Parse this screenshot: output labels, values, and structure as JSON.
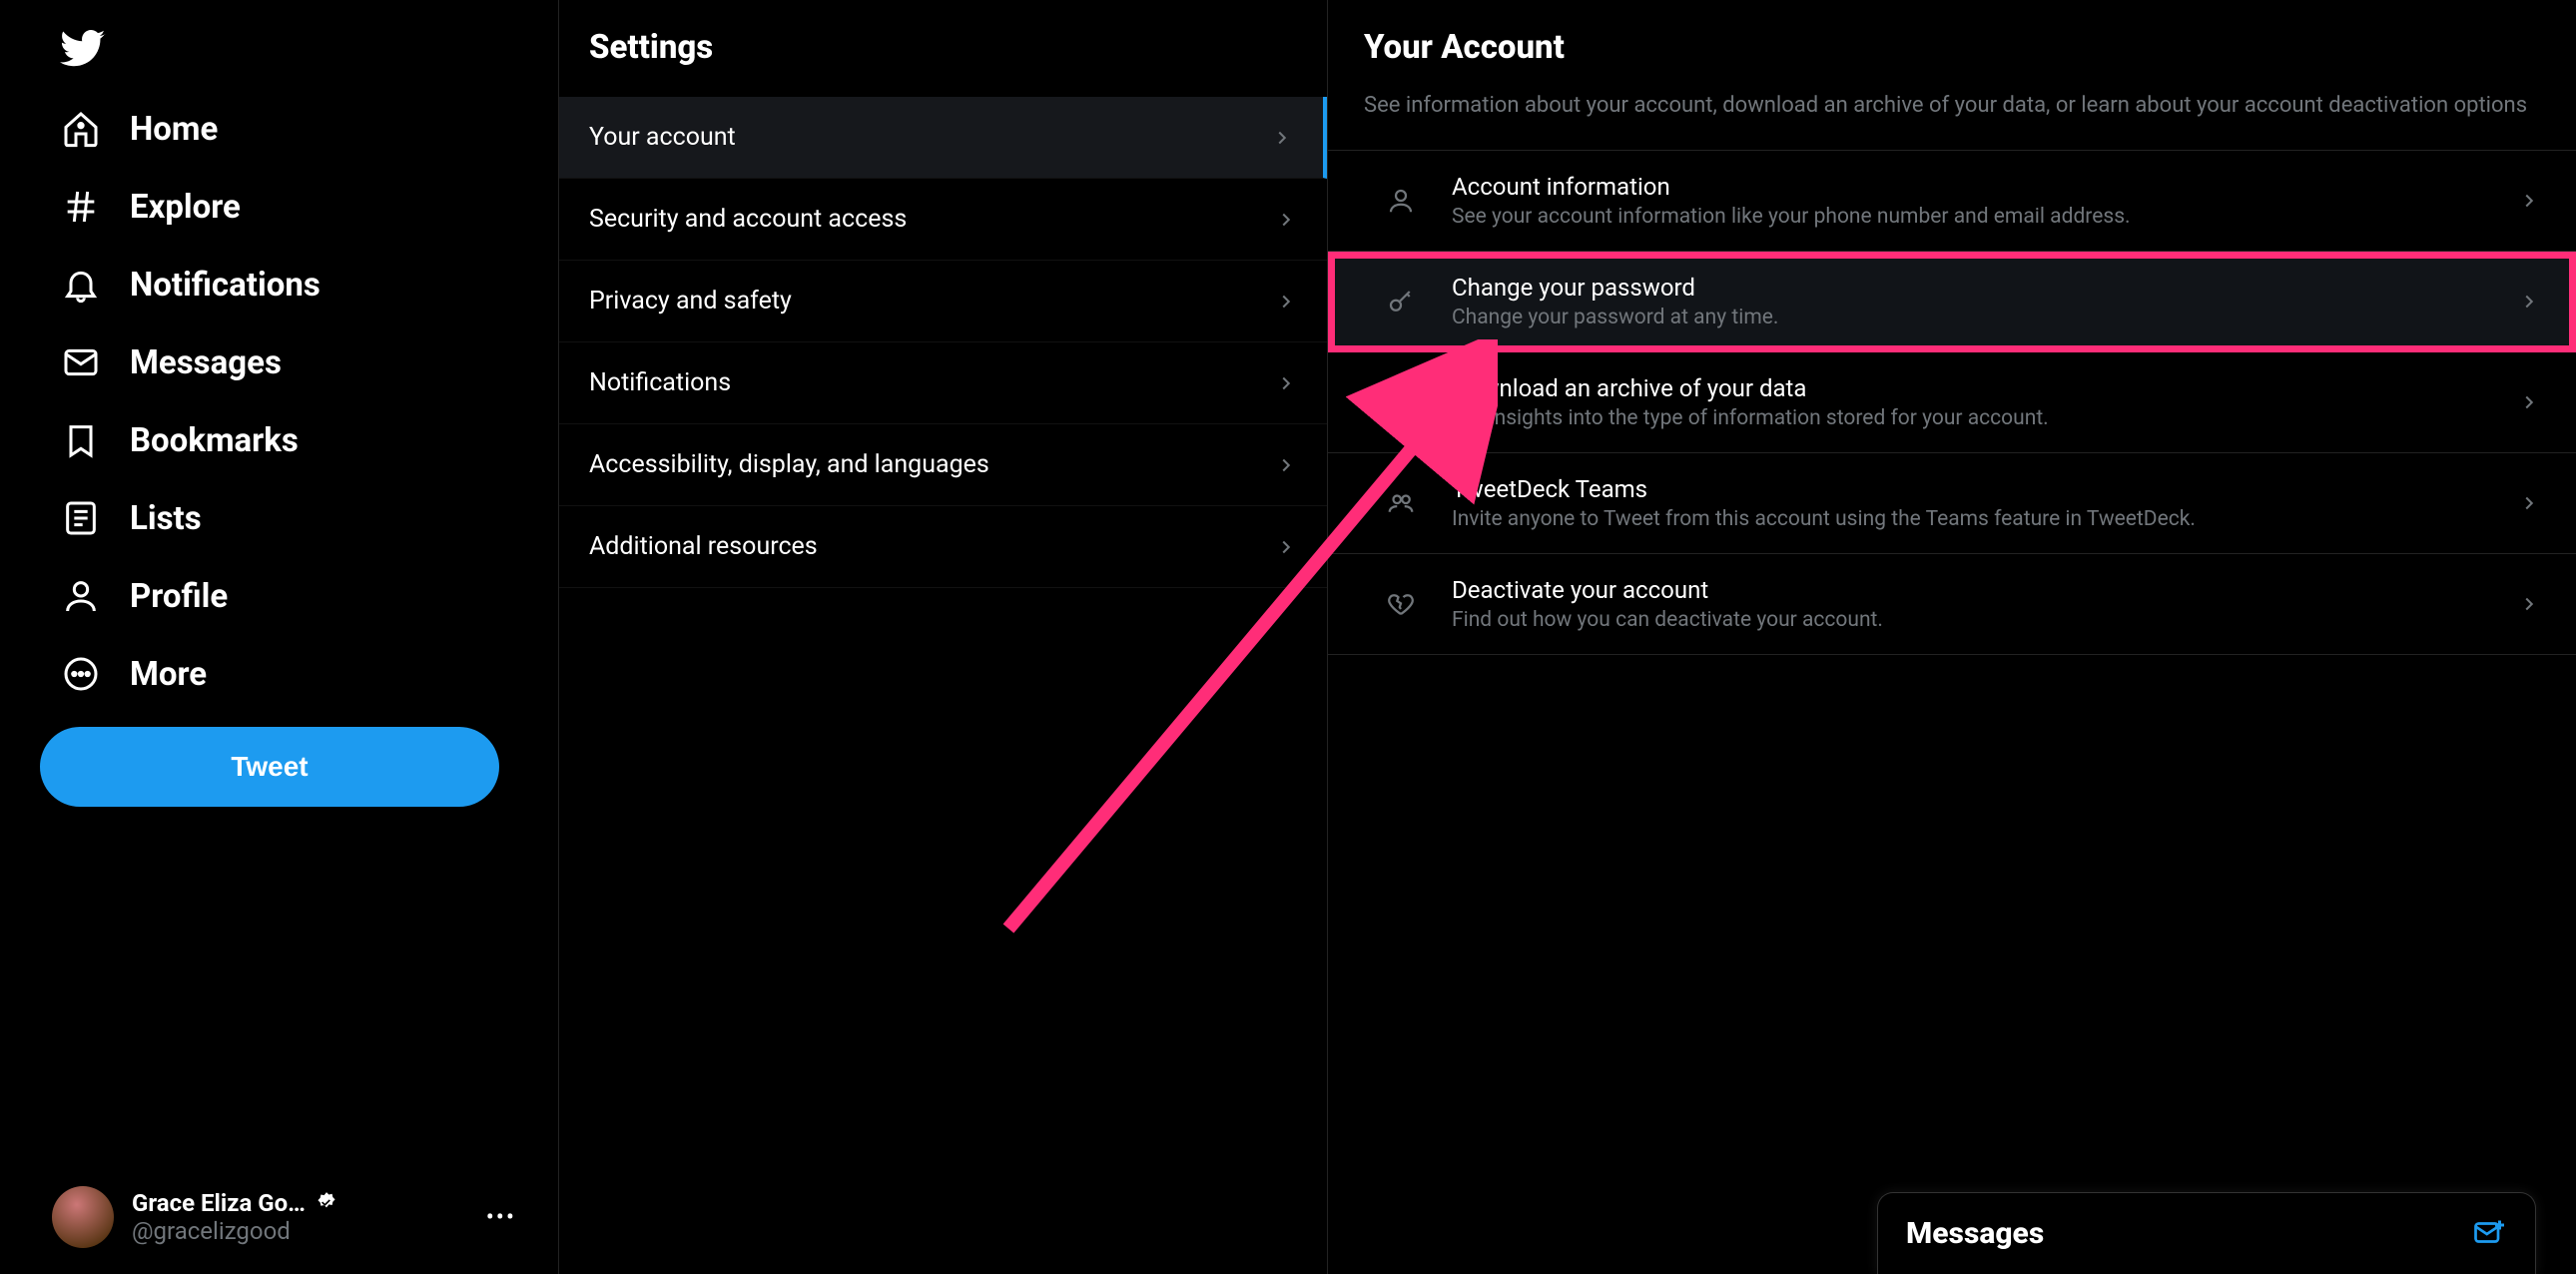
{
  "sidebar": {
    "items": [
      {
        "label": "Home"
      },
      {
        "label": "Explore"
      },
      {
        "label": "Notifications"
      },
      {
        "label": "Messages"
      },
      {
        "label": "Bookmarks"
      },
      {
        "label": "Lists"
      },
      {
        "label": "Profile"
      },
      {
        "label": "More"
      }
    ],
    "tweet_label": "Tweet",
    "profile": {
      "name": "Grace Eliza Go…",
      "handle": "@gracelizgood"
    }
  },
  "settings": {
    "title": "Settings",
    "items": [
      {
        "label": "Your account",
        "active": true
      },
      {
        "label": "Security and account access"
      },
      {
        "label": "Privacy and safety"
      },
      {
        "label": "Notifications"
      },
      {
        "label": "Accessibility, display, and languages"
      },
      {
        "label": "Additional resources"
      }
    ]
  },
  "detail": {
    "title": "Your Account",
    "description": "See information about your account, download an archive of your data, or learn about your account deactivation options",
    "items": [
      {
        "title": "Account information",
        "sub": "See your account information like your phone number and email address."
      },
      {
        "title": "Change your password",
        "sub": "Change your password at any time.",
        "highlighted": true
      },
      {
        "title": "Download an archive of your data",
        "sub": "Get insights into the type of information stored for your account."
      },
      {
        "title": "TweetDeck Teams",
        "sub": "Invite anyone to Tweet from this account using the Teams feature in TweetDeck."
      },
      {
        "title": "Deactivate your account",
        "sub": "Find out how you can deactivate your account."
      }
    ]
  },
  "drawer": {
    "title": "Messages"
  }
}
